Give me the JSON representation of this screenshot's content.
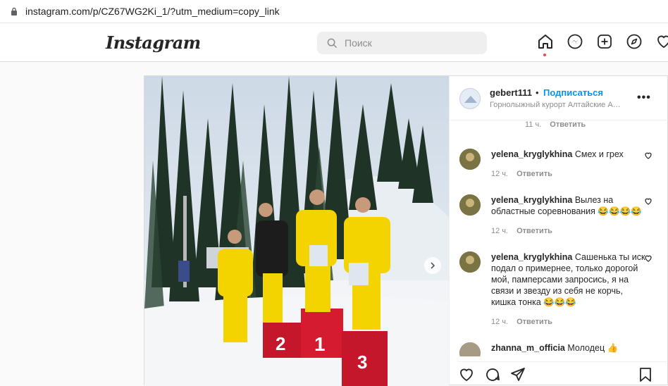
{
  "browser": {
    "url": "instagram.com/p/CZ67WG2Ki_1/?utm_medium=copy_link"
  },
  "header": {
    "logo": "Instagram",
    "search_placeholder": "Поиск",
    "nav_icons": [
      "home-icon",
      "messenger-icon",
      "new-post-icon",
      "explore-icon",
      "activity-heart-icon"
    ],
    "active_dot_color": "#ed4956"
  },
  "post": {
    "author": "gebert111",
    "separator": "•",
    "follow_label": "Подписаться",
    "location": "Горнолыжный курорт Алтайские Альпы",
    "more_label": "•••",
    "prev_meta": {
      "time": "11 ч.",
      "reply": "Ответить"
    },
    "comments": [
      {
        "user": "yelena_kryglykhina",
        "text": "Смех и грех",
        "time": "12 ч.",
        "reply": "Ответить"
      },
      {
        "user": "yelena_kryglykhina",
        "text": "Вылез на областные соревнования 😂😂😂😂",
        "time": "12 ч.",
        "reply": "Ответить"
      },
      {
        "user": "yelena_kryglykhina",
        "text": "Сашенька ты иск подал о примернее, только дорогой мой, памперсами запросись, я на связи и звезду из себя не корчь, кишка тонка 😂😂😂",
        "time": "12 ч.",
        "reply": "Ответить"
      },
      {
        "user": "zhanna_m_officia",
        "text": "Молодец 👍",
        "time": "",
        "reply": ""
      }
    ],
    "podium_numbers": [
      "2",
      "1",
      "3"
    ],
    "action_icons": [
      "like-icon",
      "comment-icon",
      "share-icon",
      "save-icon"
    ],
    "accent_color": "#0095f6"
  }
}
